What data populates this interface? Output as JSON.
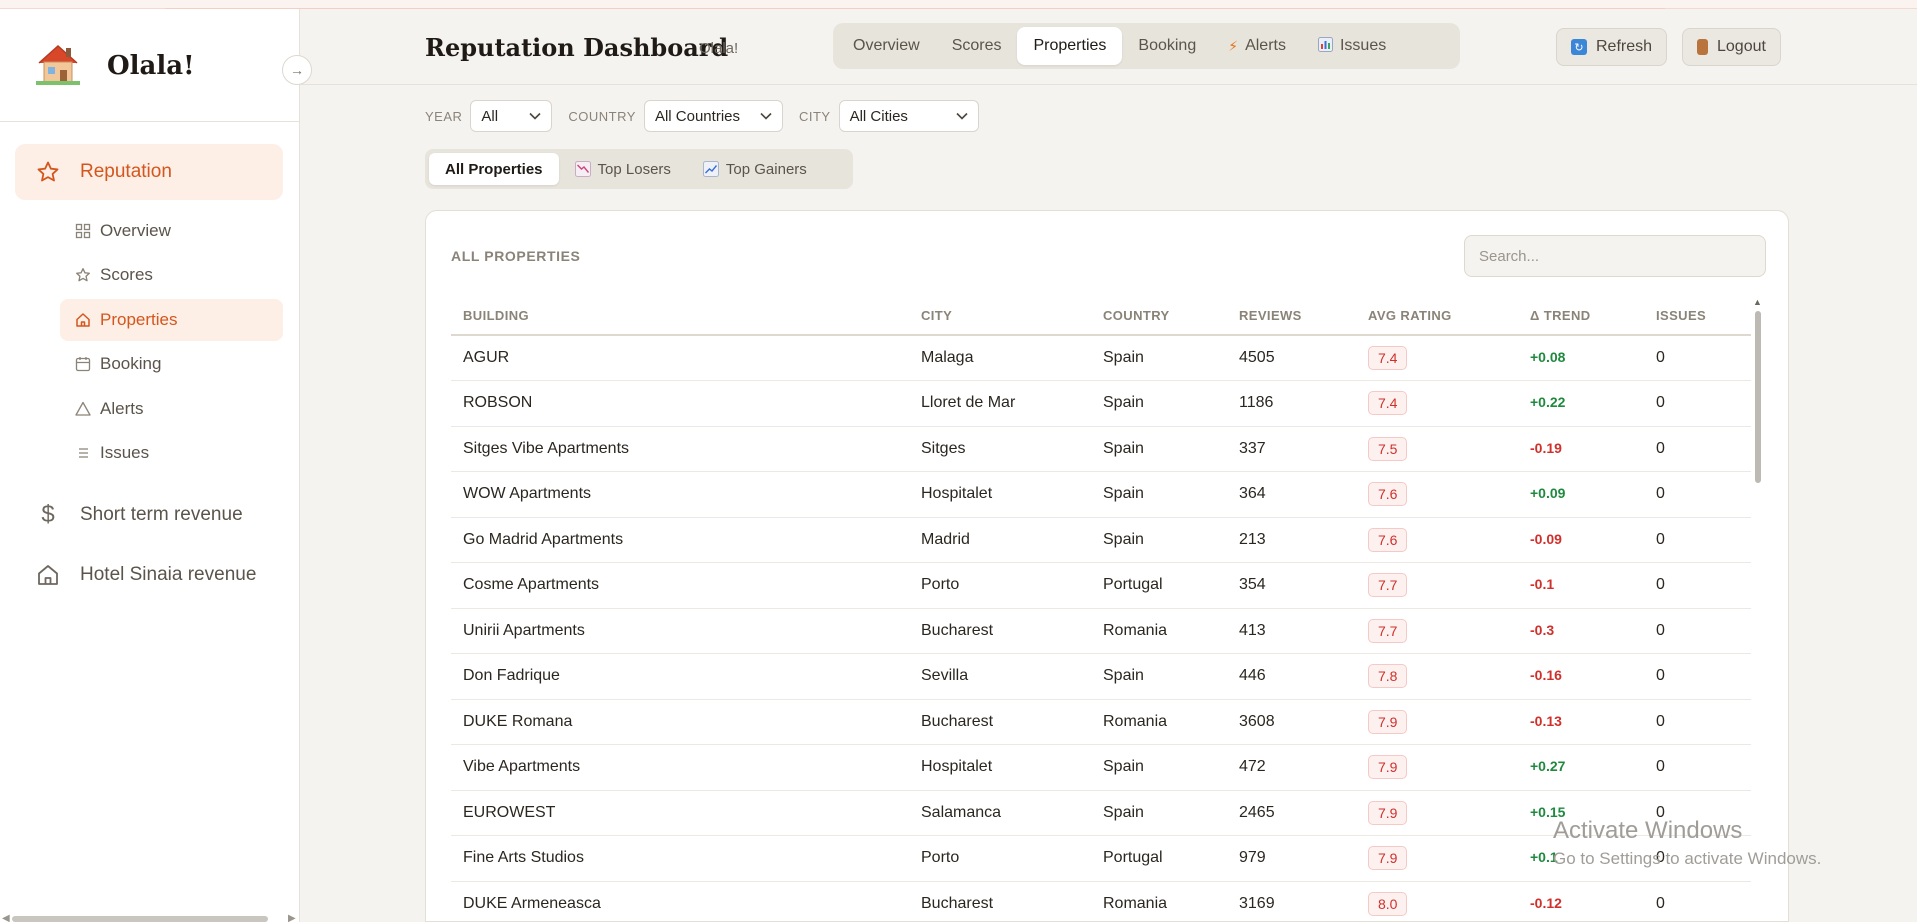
{
  "brand": {
    "name": "Olala!",
    "collapse_icon": "→"
  },
  "sidebar": {
    "main": [
      {
        "label": "Reputation",
        "icon": "star-icon",
        "active": true
      },
      {
        "label": "Short term revenue",
        "icon": "dollar-icon",
        "active": false
      },
      {
        "label": "Hotel Sinaia revenue",
        "icon": "home-icon",
        "active": false
      }
    ],
    "sub": [
      {
        "label": "Overview",
        "icon": "grid-icon",
        "active": false
      },
      {
        "label": "Scores",
        "icon": "star-icon",
        "active": false
      },
      {
        "label": "Properties",
        "icon": "home-icon",
        "active": true
      },
      {
        "label": "Booking",
        "icon": "calendar-icon",
        "active": false
      },
      {
        "label": "Alerts",
        "icon": "warning-icon",
        "active": false
      },
      {
        "label": "Issues",
        "icon": "list-icon",
        "active": false
      }
    ]
  },
  "header": {
    "title": "Reputation Dashboard",
    "subtitle": "Olala!",
    "tabs": [
      {
        "label": "Overview",
        "active": false
      },
      {
        "label": "Scores",
        "active": false
      },
      {
        "label": "Properties",
        "active": true
      },
      {
        "label": "Booking",
        "active": false
      },
      {
        "label": "Alerts",
        "icon": "lightning-icon",
        "active": false
      },
      {
        "label": "Issues",
        "icon": "bar-chart-icon",
        "active": false
      }
    ],
    "refresh_label": "Refresh",
    "logout_label": "Logout"
  },
  "filters": {
    "year_label": "YEAR",
    "year_value": "All",
    "country_label": "COUNTRY",
    "country_value": "All Countries",
    "city_label": "CITY",
    "city_value": "All Cities"
  },
  "subtabs": [
    {
      "label": "All Properties",
      "active": true
    },
    {
      "label": "Top Losers",
      "icon": "chart-down-icon",
      "active": false
    },
    {
      "label": "Top Gainers",
      "icon": "chart-up-icon",
      "active": false
    }
  ],
  "card": {
    "title": "ALL PROPERTIES",
    "search_placeholder": "Search..."
  },
  "table": {
    "columns": [
      "BUILDING",
      "CITY",
      "COUNTRY",
      "REVIEWS",
      "AVG RATING",
      "Δ TREND",
      "ISSUES"
    ],
    "rows": [
      {
        "building": "AGUR",
        "city": "Malaga",
        "country": "Spain",
        "reviews": "4505",
        "rating": "7.4",
        "trend": "+0.08",
        "issues": "0"
      },
      {
        "building": "ROBSON",
        "city": "Lloret de Mar",
        "country": "Spain",
        "reviews": "1186",
        "rating": "7.4",
        "trend": "+0.22",
        "issues": "0"
      },
      {
        "building": "Sitges Vibe Apartments",
        "city": "Sitges",
        "country": "Spain",
        "reviews": "337",
        "rating": "7.5",
        "trend": "-0.19",
        "issues": "0"
      },
      {
        "building": "WOW Apartments",
        "city": "Hospitalet",
        "country": "Spain",
        "reviews": "364",
        "rating": "7.6",
        "trend": "+0.09",
        "issues": "0"
      },
      {
        "building": "Go Madrid Apartments",
        "city": "Madrid",
        "country": "Spain",
        "reviews": "213",
        "rating": "7.6",
        "trend": "-0.09",
        "issues": "0"
      },
      {
        "building": "Cosme Apartments",
        "city": "Porto",
        "country": "Portugal",
        "reviews": "354",
        "rating": "7.7",
        "trend": "-0.1",
        "issues": "0"
      },
      {
        "building": "Unirii Apartments",
        "city": "Bucharest",
        "country": "Romania",
        "reviews": "413",
        "rating": "7.7",
        "trend": "-0.3",
        "issues": "0"
      },
      {
        "building": "Don Fadrique",
        "city": "Sevilla",
        "country": "Spain",
        "reviews": "446",
        "rating": "7.8",
        "trend": "-0.16",
        "issues": "0"
      },
      {
        "building": "DUKE Romana",
        "city": "Bucharest",
        "country": "Romania",
        "reviews": "3608",
        "rating": "7.9",
        "trend": "-0.13",
        "issues": "0"
      },
      {
        "building": "Vibe Apartments",
        "city": "Hospitalet",
        "country": "Spain",
        "reviews": "472",
        "rating": "7.9",
        "trend": "+0.27",
        "issues": "0"
      },
      {
        "building": "EUROWEST",
        "city": "Salamanca",
        "country": "Spain",
        "reviews": "2465",
        "rating": "7.9",
        "trend": "+0.15",
        "issues": "0"
      },
      {
        "building": "Fine Arts Studios",
        "city": "Porto",
        "country": "Portugal",
        "reviews": "979",
        "rating": "7.9",
        "trend": "+0.1",
        "issues": "0"
      },
      {
        "building": "DUKE Armeneasca",
        "city": "Bucharest",
        "country": "Romania",
        "reviews": "3169",
        "rating": "8.0",
        "trend": "-0.12",
        "issues": "0"
      }
    ]
  },
  "watermark": {
    "line1": "Activate Windows",
    "line2": "Go to Settings to activate Windows."
  },
  "colors": {
    "accent": "#d4561d",
    "accent_bg": "#fdeee6",
    "positive": "#1f8a3e",
    "negative": "#d0302b",
    "background": "#f4f3ef"
  }
}
